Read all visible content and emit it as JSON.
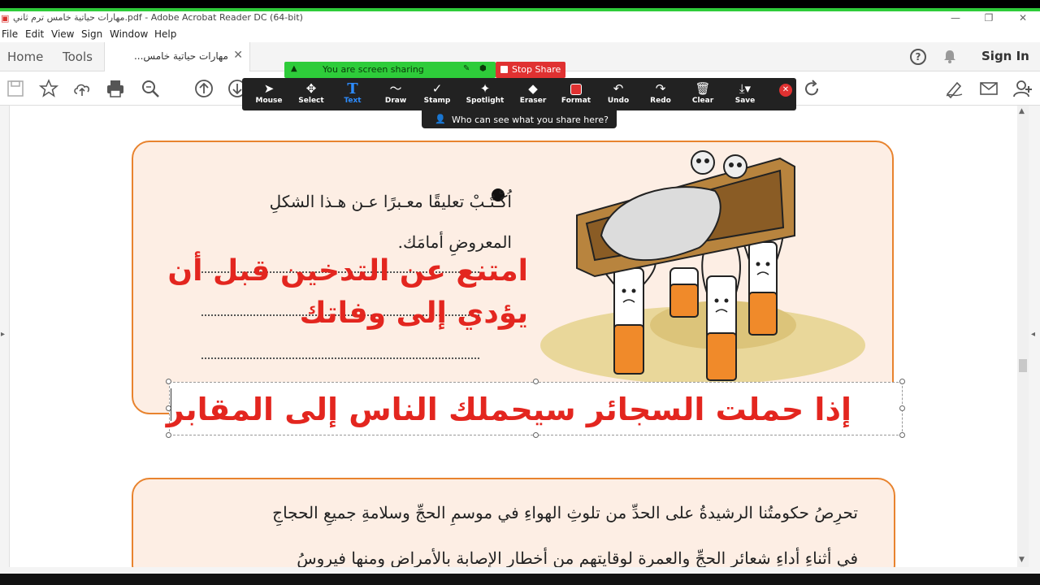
{
  "window": {
    "title": "مهارات حياتية خامس ترم ثاني.pdf - Adobe Acrobat Reader DC (64-bit)"
  },
  "menu": [
    "File",
    "Edit",
    "View",
    "Sign",
    "Window",
    "Help"
  ],
  "tabs": {
    "home": "Home",
    "tools": "Tools",
    "document": "مهارات حياتية خامس...",
    "sign_in": "Sign In"
  },
  "zoom": {
    "sharing_text": "You are screen sharing",
    "stop_share": "Stop Share",
    "who_can_see": "Who can see what you share here?",
    "tools": [
      {
        "label": "Mouse",
        "icon": "pointer-icon"
      },
      {
        "label": "Select",
        "icon": "move-icon"
      },
      {
        "label": "Text",
        "icon": "text-icon"
      },
      {
        "label": "Draw",
        "icon": "draw-icon"
      },
      {
        "label": "Stamp",
        "icon": "check-icon"
      },
      {
        "label": "Spotlight",
        "icon": "spotlight-icon"
      },
      {
        "label": "Eraser",
        "icon": "eraser-icon"
      },
      {
        "label": "Format",
        "icon": "format-icon"
      },
      {
        "label": "Undo",
        "icon": "undo-icon"
      },
      {
        "label": "Redo",
        "icon": "redo-icon"
      },
      {
        "label": "Clear",
        "icon": "trash-icon"
      },
      {
        "label": "Save",
        "icon": "save-icon"
      }
    ],
    "active_tool": "Text",
    "accent": "#2d8cff"
  },
  "document": {
    "question_line1": "اُكْـتُـبْ تعليقًا معـبرًا عـن هـذا الشكلِ",
    "question_line2": "المعروضِ أمامَك.",
    "answer_red": "امتنع عن التدخين قبل أن يؤدي إلى وفاتك",
    "textbox_red": "إذا حملت السجائر سيحملك الناس إلى المقابر",
    "para_line1": "تحرِصُ حكومتُنا الرشيدةُ على الحدِّ من تلوثِ الهواءِ في موسمِ الحجِّ وسلامةِ جميعِ الحجاجِ",
    "para_line2": "في أثناءِ أداءِ شعائرِ الحجِّ والعمرة لوقايتهم من أخطارِ الإصابة بالأمراضِ ومنها فيروسُ"
  },
  "colors": {
    "red_text": "#e3261f",
    "card_border": "#e8832e",
    "card_fill": "#fdeee4",
    "zoom_green": "#2ecc3a",
    "stop_red": "#e03131"
  }
}
